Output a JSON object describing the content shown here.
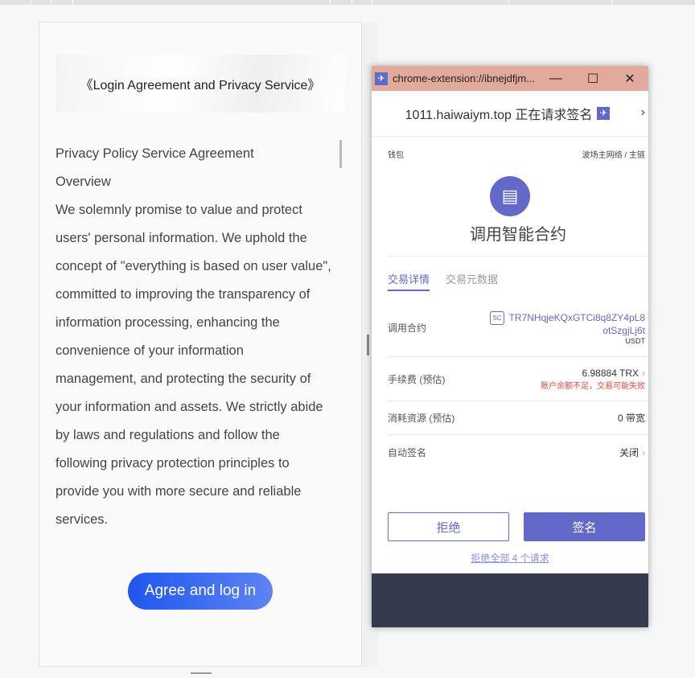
{
  "page": {
    "title": "《Login Agreement and Privacy Service》",
    "lines": [
      "Privacy Policy Service Agreement",
      "Overview",
      "We solemnly promise to value and protect",
      "users' personal information. We uphold the",
      "concept of \"everything is based on user value\",",
      "committed to improving the transparency of",
      "information processing, enhancing the",
      "convenience of your information",
      "management, and protecting the security of",
      "your information and assets. We strictly abide",
      "by laws and regulations and follow the",
      "following privacy protection principles to",
      "provide you with more secure and reliable",
      "services."
    ],
    "agree_label": "Agree and log in"
  },
  "popup": {
    "window_title": "chrome-extension://ibnejdfjm...",
    "minimize": "—",
    "maximize": "☐",
    "close": "✕",
    "header": "1011.haiwaiym.top 正在请求签名",
    "wallet": "钱包",
    "network": "波场主网络 / 主链",
    "contract_title": "调用智能合约",
    "tabs": [
      "交易详情",
      "交易元数据"
    ],
    "rows": {
      "contract": {
        "label": "调用合约",
        "badge": "SC",
        "address1": "TR7NHqjeKQxGTCi8q8ZY4pL8",
        "address2": "otSzgjLj6t",
        "token": "USDT"
      },
      "fee": {
        "label": "手续费 (预估)",
        "value": "6.98884 TRX",
        "warning": "账户余额不足，交易可能失败"
      },
      "resource": {
        "label": "消耗资源 (预估)",
        "value": "0 带宽"
      },
      "autosign": {
        "label": "自动签名",
        "value": "关闭"
      }
    },
    "reject": "拒绝",
    "sign": "签名",
    "reject_all": "拒绝全部 4 个请求",
    "accent": "#6369c8",
    "titlebar_color": "#e2aa9a"
  }
}
